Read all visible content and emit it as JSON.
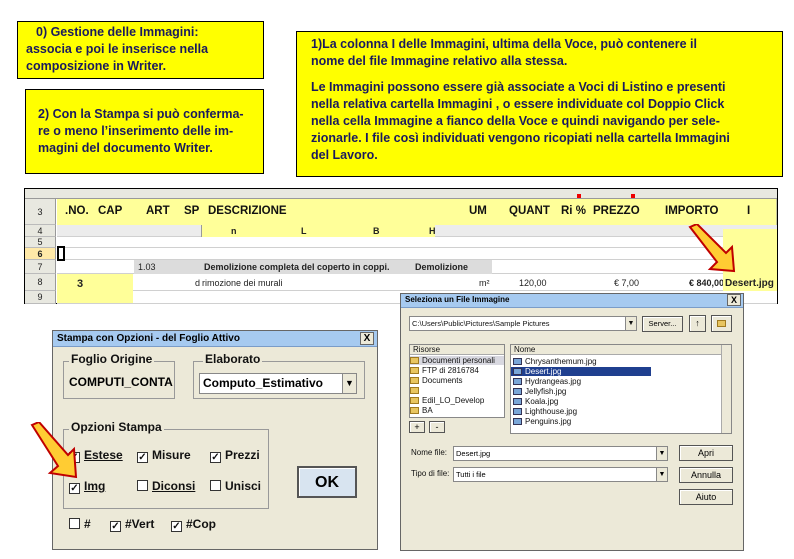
{
  "notes": {
    "n0": {
      "line1": "0) Gestione delle Immagini:",
      "line2": "associa e poi le inserisce nella",
      "line3": "composizione in Writer."
    },
    "n2": {
      "line1": "2) Con la Stampa si può conferma-",
      "line2": "re o meno l’inserimento delle im-",
      "line3": "magini del documento Writer."
    },
    "n1": {
      "line1": "1)La colonna I delle Immagini, ultima della Voce, può contenere il",
      "line2": "nome del file Immagine relativo alla stessa.",
      "line3": " Le Immagini possono essere già associate a Voci di Listino e presenti",
      "line4": "nella relativa cartella Immagini , o essere individuate col Doppio Click",
      "line5": "nella cella Immagine a fianco della Voce e quindi navigando per sele-",
      "line6": "zionarle. I file così individuati vengono ricopiati nella cartella Immagini",
      "line7": "del Lavoro."
    }
  },
  "sheet": {
    "headers": {
      "row": "3",
      "no": ".NO.",
      "cap": "CAP",
      "art": "ART",
      "sp": "SP",
      "descr": "DESCRIZIONE",
      "um": "UM",
      "quant": "QUANT",
      "ri": "Ri %",
      "prezzo": "PREZZO",
      "importo": "IMPORTO",
      "i": "I"
    },
    "subheaders": {
      "row": "4",
      "n": "n",
      "l": "L",
      "b": "B",
      "h": "H"
    },
    "rows": [
      "5",
      "6",
      "7",
      "8",
      "9"
    ],
    "r7": {
      "art": "1.03",
      "descr": "Demolizione completa del coperto in coppi.",
      "cat": "Demolizione"
    },
    "r8": {
      "no": "3",
      "sp": "d",
      "descr": "rimozione dei murali",
      "um": "m²",
      "quant": "120,00",
      "prezzo": "€ 7,00",
      "importo": "€ 840,00",
      "img": "Desert.jpg"
    }
  },
  "print_dialog": {
    "title": "Stampa con Opzioni - del Foglio Attivo",
    "close": "X",
    "foglio_label": "Foglio Origine",
    "foglio_value": "COMPUTI_CONTA",
    "elaborato_label": "Elaborato",
    "elaborato_value": "Computo_Estimativo",
    "opzioni_label": "Opzioni Stampa",
    "estese": "Estese",
    "misure": "Misure",
    "prezzi": "Prezzi",
    "img": "Img",
    "diconsi": "Diconsi",
    "unisci": "Unisci",
    "hash": "#",
    "vert": "#Vert",
    "cop": "#Cop",
    "ok": "OK",
    "checked": {
      "estese": true,
      "misure": true,
      "prezzi": true,
      "img": true,
      "diconsi": false,
      "unisci": false,
      "hash": false,
      "vert": true,
      "cop": true
    }
  },
  "file_dialog": {
    "title": "Seleziona un File Immagine",
    "close": "X",
    "path": "C:\\Users\\Public\\Pictures\\Sample Pictures",
    "server_btn": "Server...",
    "risorse_label": "Risorse",
    "nome_label": "Nome",
    "risorse": [
      "Documenti personali",
      "FTP di 2816784",
      "Documents",
      "",
      "Edil_LO_Develop",
      "BA",
      ""
    ],
    "files": [
      "Chrysanthemum.jpg",
      "Desert.jpg",
      "Hydrangeas.jpg",
      "Jellyfish.jpg",
      "Koala.jpg",
      "Lighthouse.jpg",
      "Penguins.jpg"
    ],
    "selected": "Desert.jpg",
    "plus": "+",
    "minus": "-",
    "nome_file_label": "Nome file:",
    "nome_file_value": "Desert.jpg",
    "tipo_label": "Tipo di file:",
    "tipo_value": "Tutti i file",
    "apri": "Apri",
    "annulla": "Annulla",
    "aiuto": "Aiuto"
  }
}
